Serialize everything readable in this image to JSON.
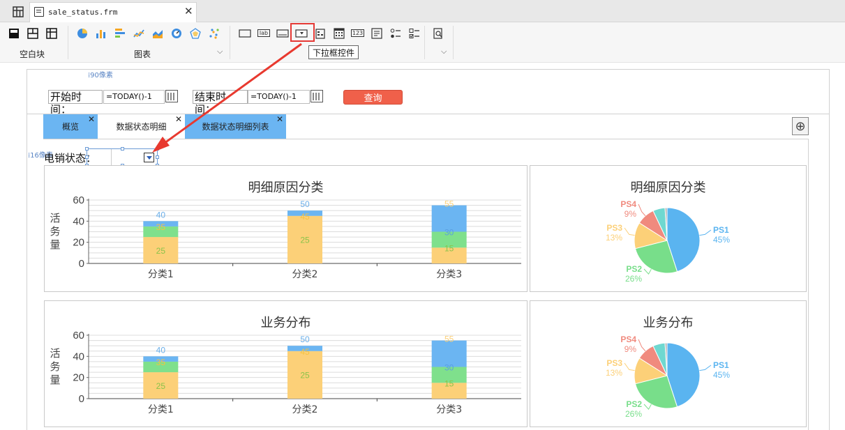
{
  "file_tab": {
    "name": "sale_status.frm"
  },
  "toolbar": {
    "group_blank": "空白块",
    "group_chart": "图表",
    "tooltip": "下拉框控件",
    "widget_lab": "lab",
    "widget_123": "123"
  },
  "hints": {
    "px90": "⁞90像素",
    "px16": "⁞16像素"
  },
  "filter": {
    "start_label": "开始时间：",
    "start_value": "=TODAY()-1",
    "end_label": "结束时间：",
    "end_value": "=TODAY()-1",
    "query_button": "查询"
  },
  "report_tabs": [
    {
      "label": "概览",
      "bg": "#6bb5f2"
    },
    {
      "label": "数据状态明细",
      "bg": "#ffffff"
    },
    {
      "label": "数据状态明细列表",
      "bg": "#6bb5f2"
    }
  ],
  "status_filter": {
    "label": "电销状态："
  },
  "colors": {
    "accent_blue": "#6bb5f2",
    "query_red": "#f0604a",
    "highlight_red": "#e53935",
    "arrow_red": "#e8392f"
  },
  "chart_data": [
    {
      "type": "bar",
      "title": "明细原因分类",
      "ylabel": "活务量",
      "categories": [
        "分类1",
        "分类2",
        "分类3"
      ],
      "ylim": [
        0,
        60
      ],
      "yticks": [
        0,
        20,
        40,
        60
      ],
      "series": [
        {
          "values": [
            25,
            45,
            15
          ],
          "color": "#fcd078",
          "labels": [
            "25",
            "25",
            "15"
          ]
        },
        {
          "values": [
            10,
            0,
            15
          ],
          "color": "#7fe08c",
          "labels": [
            "35",
            "45",
            "30"
          ]
        },
        {
          "values": [
            5,
            5,
            25
          ],
          "color": "#6bb5f2",
          "labels": [
            "40",
            "50",
            "55"
          ]
        }
      ],
      "grid": true
    },
    {
      "type": "pie",
      "title": "明细原因分类",
      "slices": [
        {
          "name": "PS1",
          "label": "45%",
          "value": 45,
          "color": "#5ab4f0"
        },
        {
          "name": "PS2",
          "label": "26%",
          "value": 26,
          "color": "#78de8a"
        },
        {
          "name": "PS3",
          "label": "13%",
          "value": 13,
          "color": "#fcd078"
        },
        {
          "name": "PS4",
          "label": "9%",
          "value": 9,
          "color": "#f08a7e"
        },
        {
          "name": "",
          "label": "",
          "value": 6,
          "color": "#6fd8d0"
        },
        {
          "name": "",
          "label": "",
          "value": 1,
          "color": "#b0b0b0"
        }
      ]
    },
    {
      "type": "bar",
      "title": "业务分布",
      "ylabel": "活务量",
      "categories": [
        "分类1",
        "分类2",
        "分类3"
      ],
      "ylim": [
        0,
        60
      ],
      "yticks": [
        0,
        20,
        40,
        60
      ],
      "series": [
        {
          "values": [
            25,
            45,
            15
          ],
          "color": "#fcd078",
          "labels": [
            "25",
            "25",
            "15"
          ]
        },
        {
          "values": [
            10,
            0,
            15
          ],
          "color": "#7fe08c",
          "labels": [
            "35",
            "45",
            "30"
          ]
        },
        {
          "values": [
            5,
            5,
            25
          ],
          "color": "#6bb5f2",
          "labels": [
            "40",
            "50",
            "55"
          ]
        }
      ],
      "grid": true
    },
    {
      "type": "pie",
      "title": "业务分布",
      "slices": [
        {
          "name": "PS1",
          "label": "45%",
          "value": 45,
          "color": "#5ab4f0"
        },
        {
          "name": "PS2",
          "label": "26%",
          "value": 26,
          "color": "#78de8a"
        },
        {
          "name": "PS3",
          "label": "13%",
          "value": 13,
          "color": "#fcd078"
        },
        {
          "name": "PS4",
          "label": "9%",
          "value": 9,
          "color": "#f08a7e"
        },
        {
          "name": "",
          "label": "",
          "value": 6,
          "color": "#6fd8d0"
        },
        {
          "name": "",
          "label": "",
          "value": 1,
          "color": "#b0b0b0"
        }
      ]
    }
  ]
}
